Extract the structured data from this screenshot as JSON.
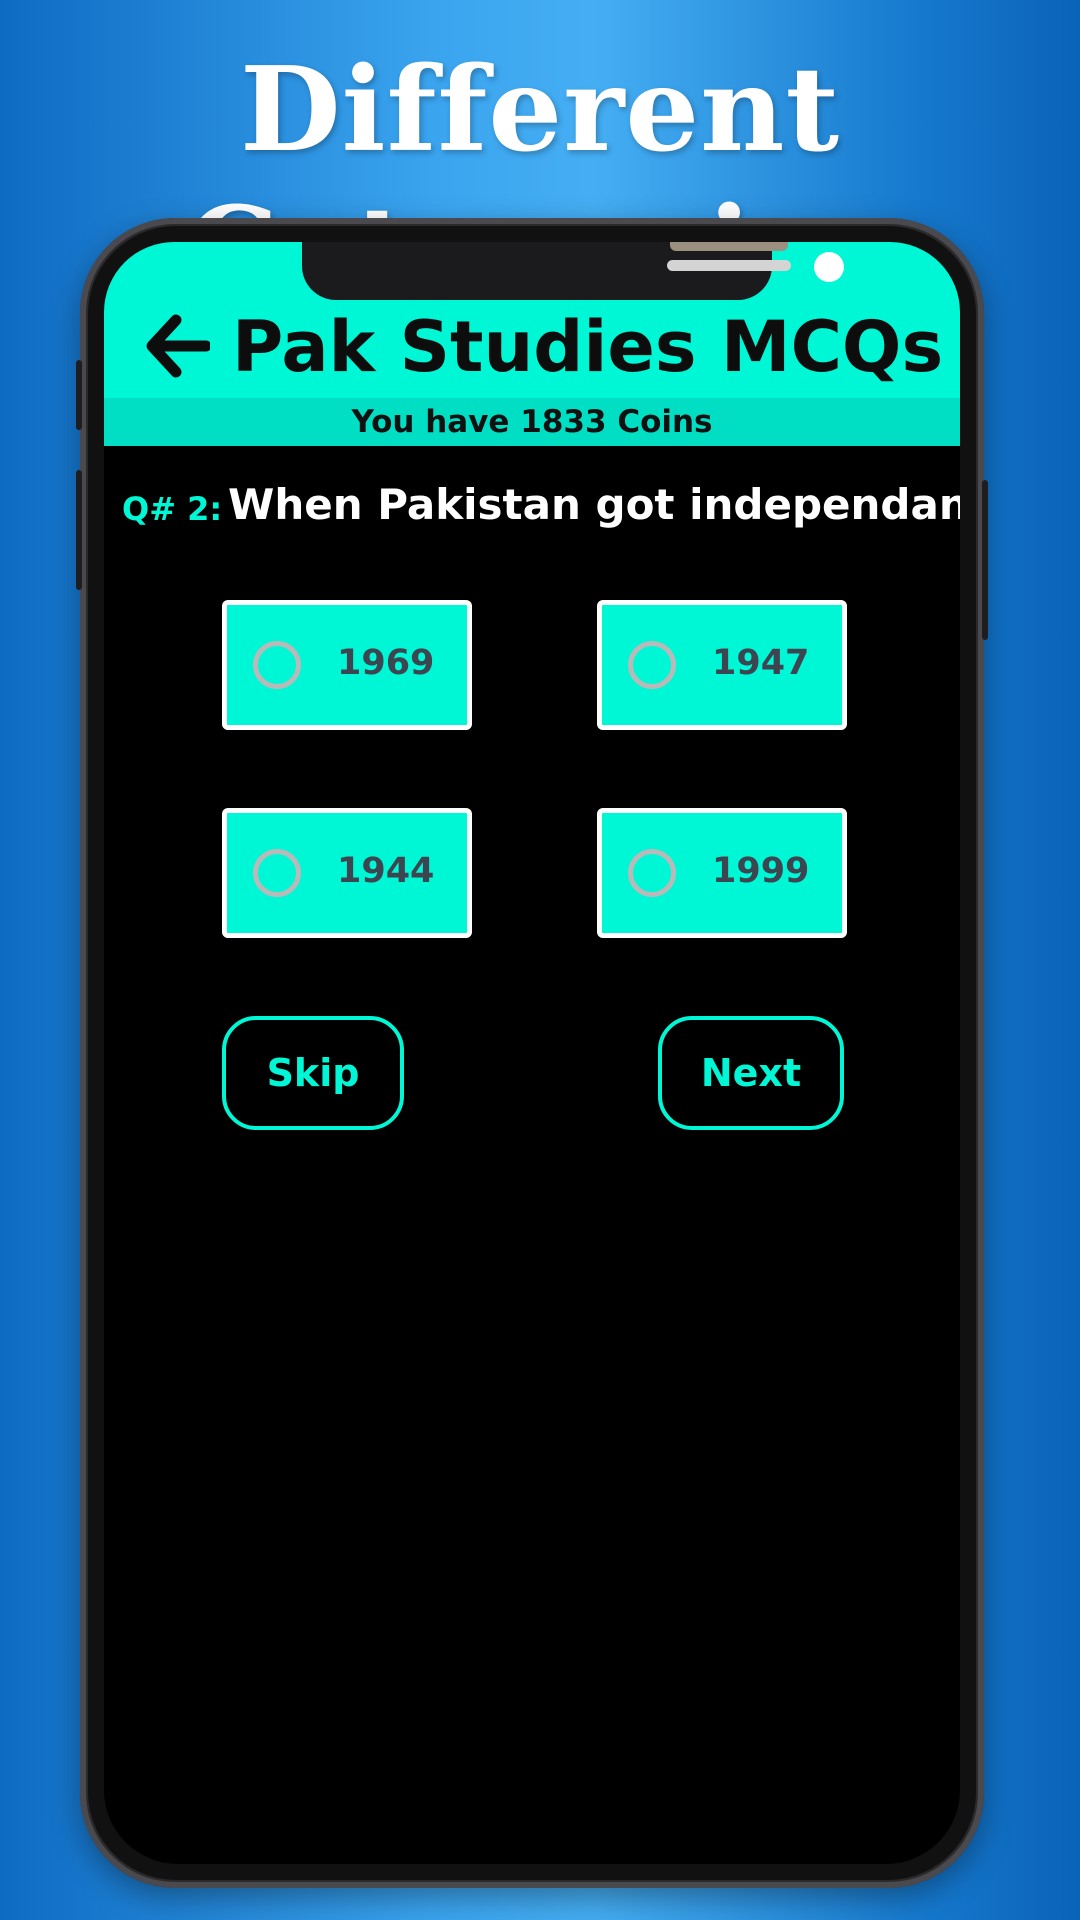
{
  "promo": {
    "headline": "Different Categories"
  },
  "header": {
    "title": "Pak Studies MCQs",
    "back_icon": "arrow-left-icon",
    "coins_text": "You have 1833 Coins"
  },
  "question": {
    "number_label": "Q# 2:",
    "text": "When Pakistan got independance?"
  },
  "options": [
    {
      "label": "1969",
      "selected": false
    },
    {
      "label": "1947",
      "selected": false
    },
    {
      "label": "1944",
      "selected": false
    },
    {
      "label": "1999",
      "selected": false
    }
  ],
  "actions": {
    "skip_label": "Skip",
    "next_label": "Next"
  },
  "colors": {
    "accent": "#00f7d6",
    "background": "#000000",
    "promo_background": "#3aa4ef"
  }
}
